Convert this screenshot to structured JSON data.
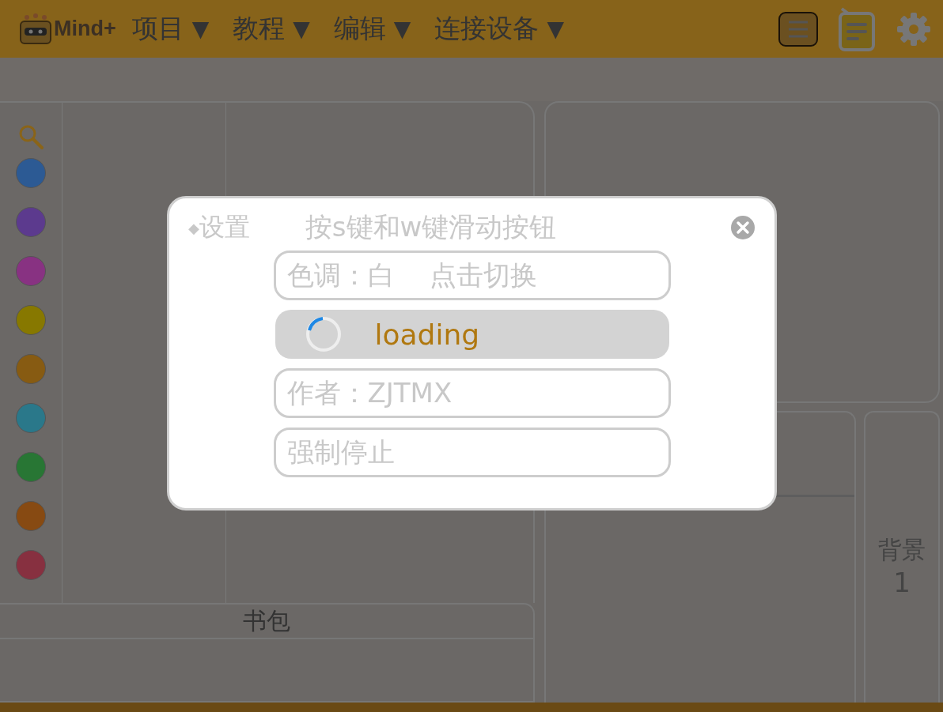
{
  "menu_bar": {
    "logo": "Mind+",
    "menus": [
      {
        "label": "项目",
        "arrow": "▼"
      },
      {
        "label": "教程",
        "arrow": "▼"
      },
      {
        "label": "编辑",
        "arrow": "▼"
      },
      {
        "label": "连接设备",
        "arrow": "▼"
      }
    ]
  },
  "categories": [
    {
      "color": "#2c5a94"
    },
    {
      "color": "#5c3a8e"
    },
    {
      "color": "#883282"
    },
    {
      "color": "#877800"
    },
    {
      "color": "#875b12"
    },
    {
      "color": "#2a788a"
    },
    {
      "color": "#287634"
    },
    {
      "color": "#874a12"
    },
    {
      "color": "#873040"
    }
  ],
  "backpack": {
    "title": "书包"
  },
  "stage_panel": {
    "label": "背景",
    "count": "1"
  },
  "dialog": {
    "bullet": "◆",
    "title": "设置",
    "hint": "按s键和w键滑动按钮",
    "items": [
      {
        "kind": "button",
        "label": "色调：白　 点击切换"
      },
      {
        "kind": "loading",
        "label": "loading"
      },
      {
        "kind": "button",
        "label": "作者：ZJTMX"
      },
      {
        "kind": "button",
        "label": "强制停止"
      }
    ]
  }
}
